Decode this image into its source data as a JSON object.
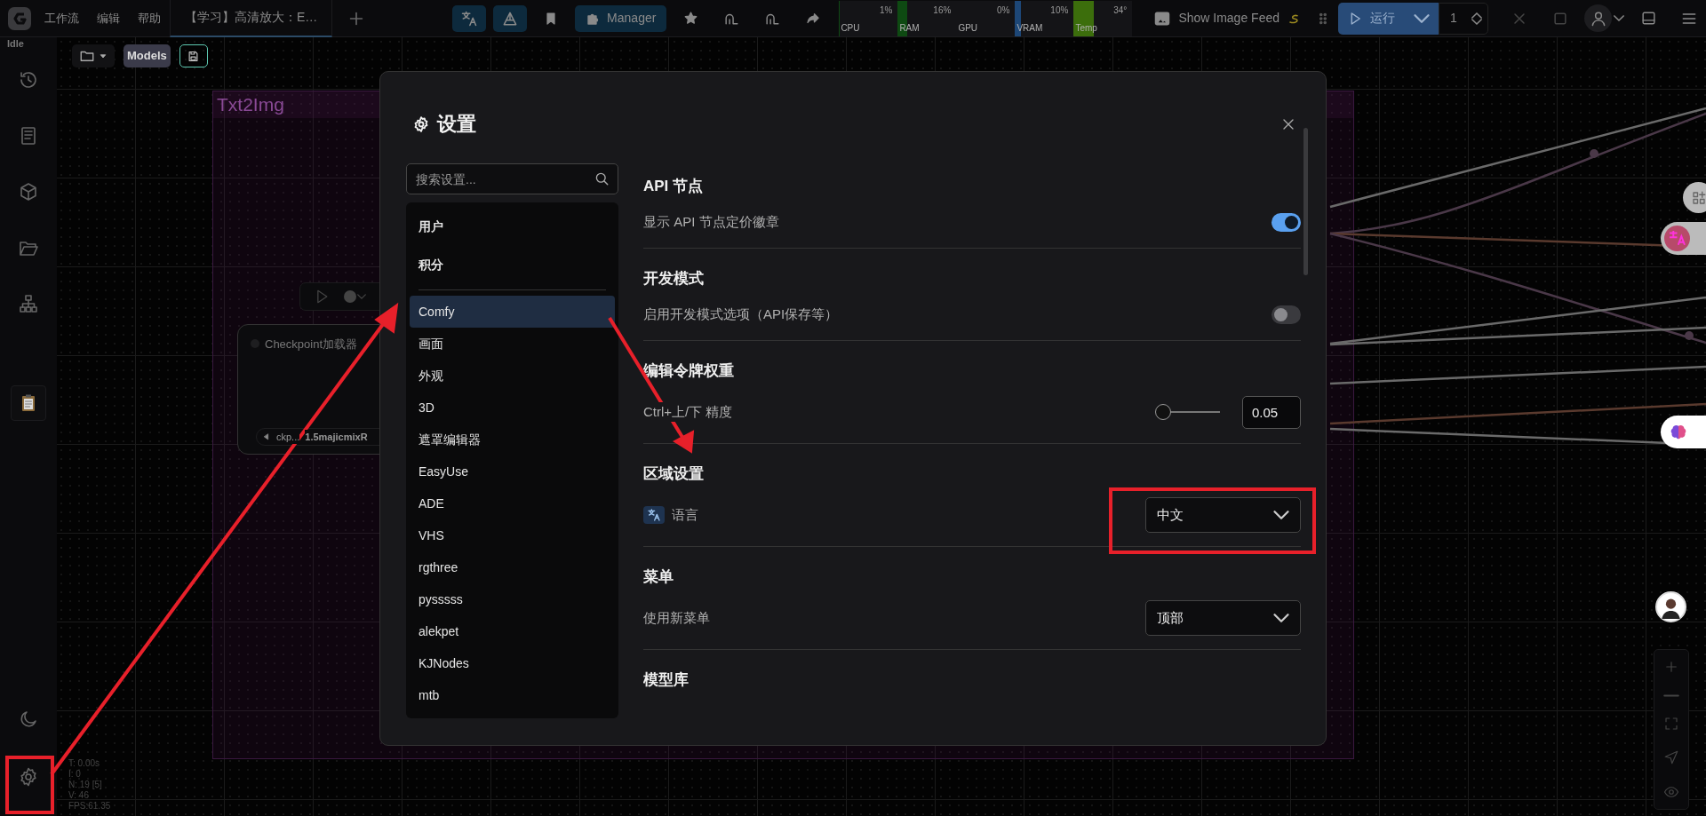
{
  "topbar": {
    "menu": [
      {
        "label": "工作流"
      },
      {
        "label": "编辑"
      },
      {
        "label": "帮助"
      }
    ],
    "tabs": [
      {
        "label": "【学习】高清放大：E…",
        "selected": true
      }
    ],
    "manager": "Manager",
    "monitors": [
      {
        "label": "CPU",
        "reading": "1%",
        "level": 0.01,
        "color": "#0e4a12"
      },
      {
        "label": "RAM",
        "reading": "16%",
        "level": 0.16,
        "color": "#0e4a12"
      },
      {
        "label": "GPU",
        "reading": "0%"
      },
      {
        "label": "VRAM",
        "reading": "10%",
        "level": 0.1,
        "color": "#1d4777"
      },
      {
        "label": "Temp",
        "reading": "34°",
        "level": 0.34,
        "color": "#3c6e0c"
      }
    ],
    "image_feed": "Show Image Feed",
    "run": "运行",
    "batch_count": "1"
  },
  "status": "Idle",
  "canvas": {
    "toolbar": {
      "models": "Models"
    },
    "group": {
      "title": "Txt2Img"
    },
    "node": {
      "title": "Checkpoint加载器",
      "widget_label": "ckp...",
      "widget_value": "1.5majicmixR"
    },
    "stats": [
      "T: 0.00s",
      "I: 0",
      "N: 19 [5]",
      "V: 46",
      "FPS:61.35"
    ]
  },
  "dialog": {
    "title": "设置",
    "search": {
      "placeholder": "搜索设置..."
    },
    "category_groups": [
      {
        "items": [
          {
            "label": "用户",
            "selected": false
          },
          {
            "label": "积分",
            "selected": false
          }
        ]
      },
      {
        "items": [
          {
            "label": "Comfy",
            "selected": true
          },
          {
            "label": "画面",
            "selected": false
          },
          {
            "label": "外观",
            "selected": false
          },
          {
            "label": "3D",
            "selected": false
          },
          {
            "label": "遮罩编辑器",
            "selected": false
          },
          {
            "label": "EasyUse",
            "selected": false
          },
          {
            "label": "ADE",
            "selected": false
          },
          {
            "label": "VHS",
            "selected": false
          },
          {
            "label": "rgthree",
            "selected": false
          },
          {
            "label": "pysssss",
            "selected": false
          },
          {
            "label": "alekpet",
            "selected": false
          },
          {
            "label": "KJNodes",
            "selected": false
          },
          {
            "label": "mtb",
            "selected": false
          }
        ]
      }
    ],
    "sections": [
      {
        "title": "API 节点",
        "settings": [
          {
            "kind": "toggle",
            "label": "显示 API 节点定价徽章",
            "on": true
          }
        ]
      },
      {
        "title": "开发模式",
        "settings": [
          {
            "kind": "toggle",
            "label": "启用开发模式选项（API保存等）",
            "on": false
          }
        ]
      },
      {
        "title": "编辑令牌权重",
        "settings": [
          {
            "kind": "slider",
            "label": "Ctrl+上/下 精度",
            "level": 0,
            "value": "0.05"
          }
        ]
      },
      {
        "title": "区域设置",
        "settings": [
          {
            "kind": "language-select",
            "label": "语言",
            "value": "中文"
          }
        ]
      },
      {
        "title": "菜单",
        "settings": [
          {
            "kind": "select",
            "label": "使用新菜单",
            "value": "顶部"
          }
        ]
      },
      {
        "title": "模型库"
      }
    ]
  }
}
